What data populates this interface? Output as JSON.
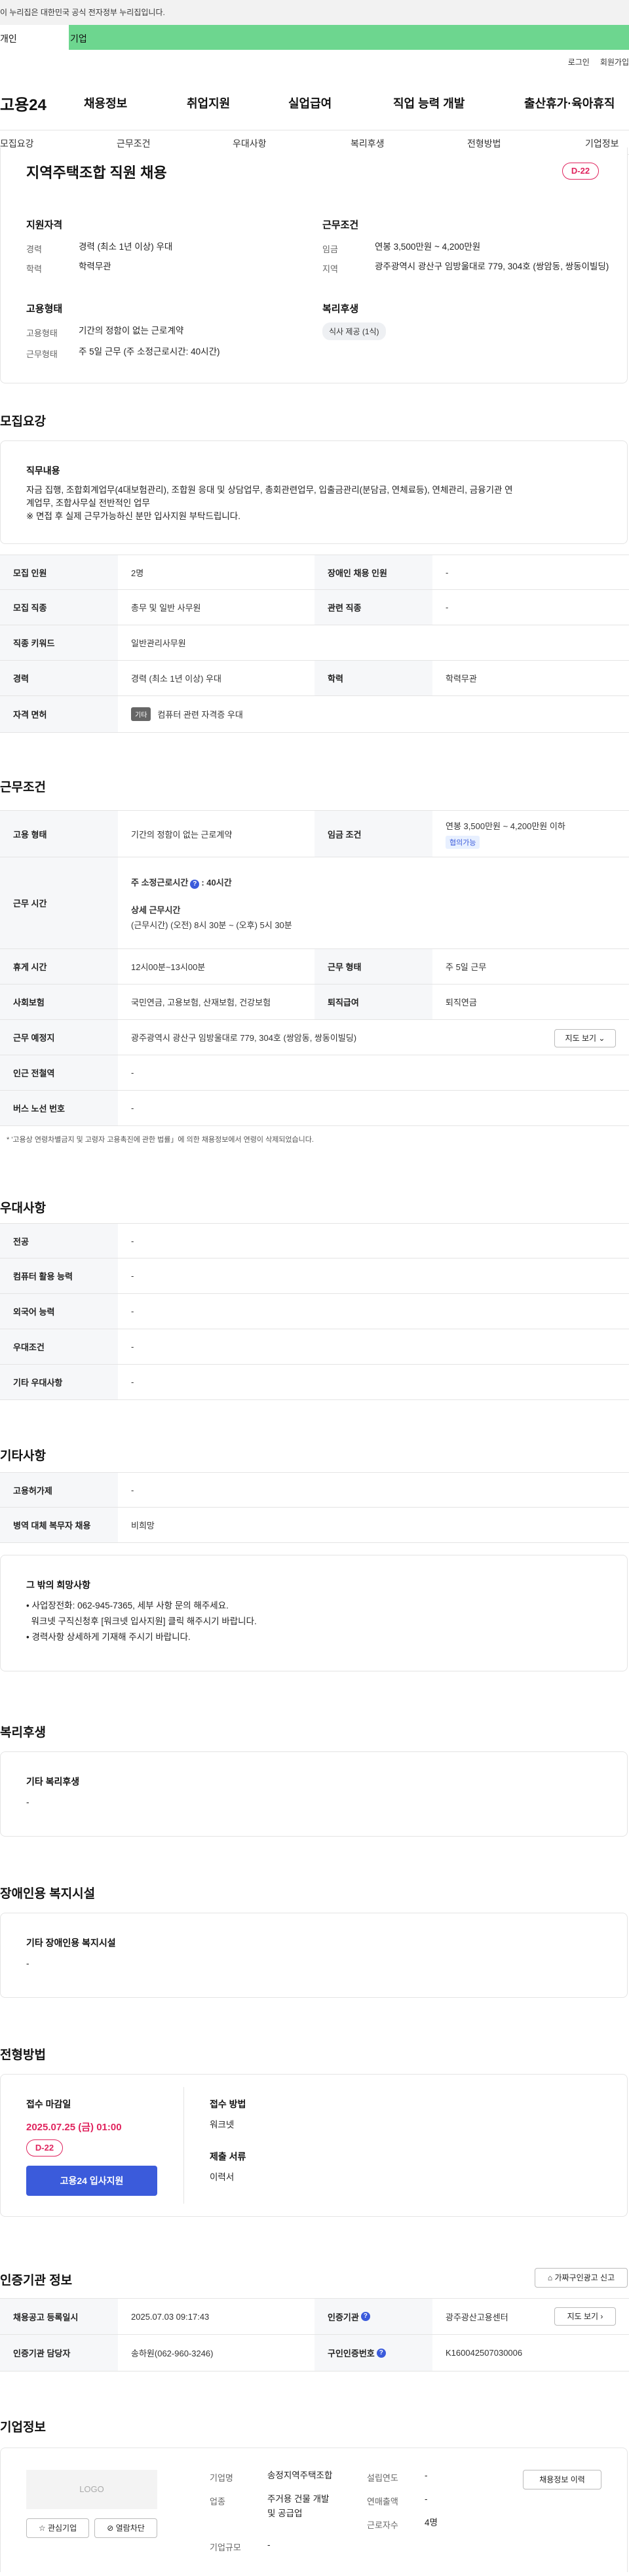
{
  "gov_banner": "이 누리집은 대한민국 공식 전자정부 누리집입니다.",
  "user_tabs": {
    "personal": "개인",
    "company": "기업"
  },
  "util": {
    "login": "로그인",
    "join": "회원가입"
  },
  "logo": "고용24",
  "gnb": [
    "채용정보",
    "취업지원",
    "실업급여",
    "직업 능력 개발",
    "출산휴가·육아휴직"
  ],
  "snb": [
    "모집요강",
    "근무조건",
    "우대사항",
    "복리후생",
    "전형방법",
    "기업정보"
  ],
  "summary": {
    "title": "지역주택조합 직원 채용",
    "dday": "D-22",
    "qual_h": "지원자격",
    "career_k": "경력",
    "career_v": "경력 (최소 1년 이상) 우대",
    "edu_k": "학력",
    "edu_v": "학력무관",
    "cond_h": "근무조건",
    "wage_k": "임금",
    "wage_v": "연봉 3,500만원 ~ 4,200만원",
    "area_k": "지역",
    "area_v": "광주광역시 광산구 임방울대로 779, 304호 (쌍암동, 쌍동이빌딩)",
    "emp_h": "고용형태",
    "emptype_k": "고용형태",
    "emptype_v": "기간의 정함이 없는 근로계약",
    "worktype_k": "근무형태",
    "worktype_v": "주 5일 근무 (주 소정근로시간: 40시간)",
    "welfare_h": "복리후생",
    "welfare_tag": "식사 제공 (1식)"
  },
  "recruit": {
    "heading": "모집요강",
    "duty_h": "직무내용",
    "duty_l1": "자금 집행, 조합회계업무(4대보험관리), 조합원 응대 및 상담업무, 총회관련업무, 입출금관리(분담금, 연체료등), 연체관리, 금융기관 연",
    "duty_l2": "계업무, 조합사무실 전반적인 업무",
    "duty_l3": "※ 면접 후 실제 근무가능하신 분만 입사지원 부탁드립니다.",
    "rows": {
      "r1a_k": "모집 인원",
      "r1a_v": "2명",
      "r1b_k": "장애인 채용 인원",
      "r1b_v": "-",
      "r2a_k": "모집 직종",
      "r2a_v": "총무 및 일반 사무원",
      "r2b_k": "관련 직종",
      "r2b_v": "-",
      "r3_k": "직종 키워드",
      "r3_v": "일반관리사무원",
      "r4a_k": "경력",
      "r4a_v": "경력 (최소 1년 이상) 우대",
      "r4b_k": "학력",
      "r4b_v": "학력무관",
      "r5_k": "자격 면허",
      "r5_badge": "기타",
      "r5_v": "컴퓨터 관련 자격증 우대"
    }
  },
  "work": {
    "heading": "근무조건",
    "emp_k": "고용 형태",
    "emp_v": "기간의 정함이 없는 근로계약",
    "wage_k": "임금 조건",
    "wage_v": "연봉 3,500만원 ~ 4,200만원 이하",
    "wage_badge": "협의가능",
    "hours_k": "근무 시간",
    "hours_l1a": "주 소정근로시간",
    "hours_l1b": ": 40시간",
    "hours_l2": "상세 근무시간",
    "hours_l3": "(근무시간) (오전) 8시 30분 ~ (오후) 5시 30분",
    "break_k": "휴게 시간",
    "break_v": "12시00분~13시00분",
    "form_k": "근무 형태",
    "form_v": "주 5일 근무",
    "ins_k": "사회보험",
    "ins_v": "국민연금, 고용보험, 산재보험, 건강보험",
    "ret_k": "퇴직급여",
    "ret_v": "퇴직연금",
    "place_k": "근무 예정지",
    "place_v": "광주광역시 광산구 임방울대로 779, 304호 (쌍암동, 쌍동이빌딩)",
    "map_btn": "지도 보기",
    "station_k": "인근 전철역",
    "station_v": "-",
    "bus_k": "버스 노선 번호",
    "bus_v": "-",
    "note": "* '고용상 연령차별금지 및 고령자 고용촉진에 관한 법률」에 의한 채용정보에서 연령이 삭제되었습니다."
  },
  "pref": {
    "heading": "우대사항",
    "r1_k": "전공",
    "r1_v": "-",
    "r2_k": "컴퓨터 활용 능력",
    "r2_v": "-",
    "r3_k": "외국어 능력",
    "r3_v": "-",
    "r4_k": "우대조건",
    "r4_v": "-",
    "r5_k": "기타 우대사항",
    "r5_v": "-"
  },
  "etc": {
    "heading": "기타사항",
    "r1_k": "고용허가제",
    "r1_v": "-",
    "r2_k": "병역 대체 복무자 채용",
    "r2_v": "비희망",
    "box_h": "그 밖의 희망사항",
    "box_l1": "• 사업장전화: 062-945-7365, 세부 사항 문의 해주세요.",
    "box_l2": "  워크넷 구직신청후 [워크넷 입사지원] 클릭 해주시기 바랍니다.",
    "box_l3": "• 경력사항 상세하게 기재해 주시기 바랍니다."
  },
  "welfare": {
    "heading": "복리후생",
    "box_h": "기타 복리후생",
    "box_v": "-"
  },
  "disabled": {
    "heading": "장애인용 복지시설",
    "box_h": "기타 장애인용 복지시설",
    "box_v": "-"
  },
  "selection": {
    "heading": "전형방법",
    "deadline_h": "접수 마감일",
    "deadline_v": "2025.07.25 (금) 01:00",
    "dday": "D-22",
    "apply": "고용24 입사지원",
    "method_h": "접수 방법",
    "method_v": "워크넷",
    "docs_h": "제출 서류",
    "docs_v": "이력서"
  },
  "cert": {
    "heading": "인증기관 정보",
    "report_btn": "가짜구인광고 신고",
    "r1a_k": "채용공고 등록일시",
    "r1a_v": "2025.07.03 09:17:43",
    "r1b_k": "인증기관",
    "r1b_v": "광주광산고용센터",
    "map_btn": "지도 보기",
    "r2a_k": "인증기관 담당자",
    "r2a_v": "송하원(062-960-3246)",
    "r2b_k": "구인인증번호",
    "r2b_v": "K160042507030006"
  },
  "company": {
    "heading": "기업정보",
    "logo": "LOGO",
    "fav_btn": "관심기업",
    "block_btn": "열람차단",
    "name_k": "기업명",
    "name_v": "송정지역주택조합",
    "ind_k": "업종",
    "ind_v1": "주거용 건물 개발",
    "ind_v2": "및 공급업",
    "size_k": "기업규모",
    "size_v": "-",
    "est_k": "설립연도",
    "est_v": "-",
    "rev_k": "연매출액",
    "rev_v": "-",
    "emp_k": "근로자수",
    "emp_v": "4명",
    "history_btn": "채용정보 이력"
  },
  "colors": {
    "accent_green": "#6dd68f",
    "dday_pink": "#e0245e",
    "apply_blue": "#3b5bdb"
  }
}
